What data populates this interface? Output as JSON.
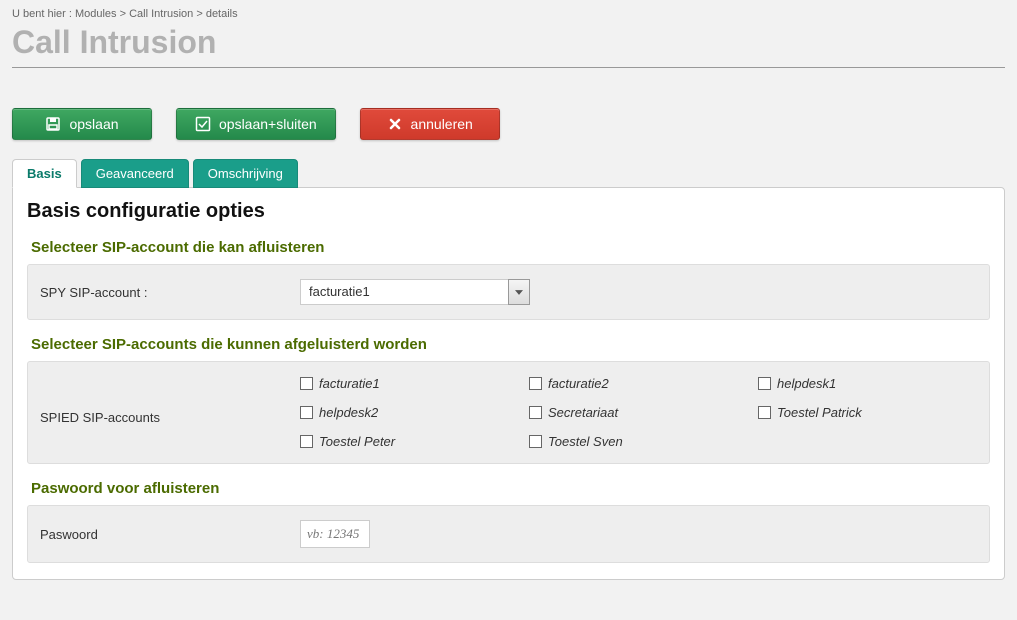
{
  "breadcrumb": "U bent hier : Modules > Call Intrusion > details",
  "page_title": "Call Intrusion",
  "toolbar": {
    "save": "opslaan",
    "save_close": "opslaan+sluiten",
    "cancel": "annuleren"
  },
  "tabs": {
    "basis": "Basis",
    "advanced": "Geavanceerd",
    "description": "Omschrijving"
  },
  "panel": {
    "heading": "Basis configuratie opties",
    "spy_section_title": "Selecteer SIP-account die kan afluisteren",
    "spy_label": "SPY SIP-account :",
    "spy_selected": "facturatie1",
    "spied_section_title": "Selecteer SIP-accounts die kunnen afgeluisterd worden",
    "spied_label": "SPIED SIP-accounts",
    "spied_options": [
      "facturatie1",
      "facturatie2",
      "helpdesk1",
      "helpdesk2",
      "Secretariaat",
      "Toestel Patrick",
      "Toestel Peter",
      "Toestel Sven"
    ],
    "password_section_title": "Paswoord voor afluisteren",
    "password_label": "Paswoord",
    "password_placeholder": "vb: 12345"
  }
}
